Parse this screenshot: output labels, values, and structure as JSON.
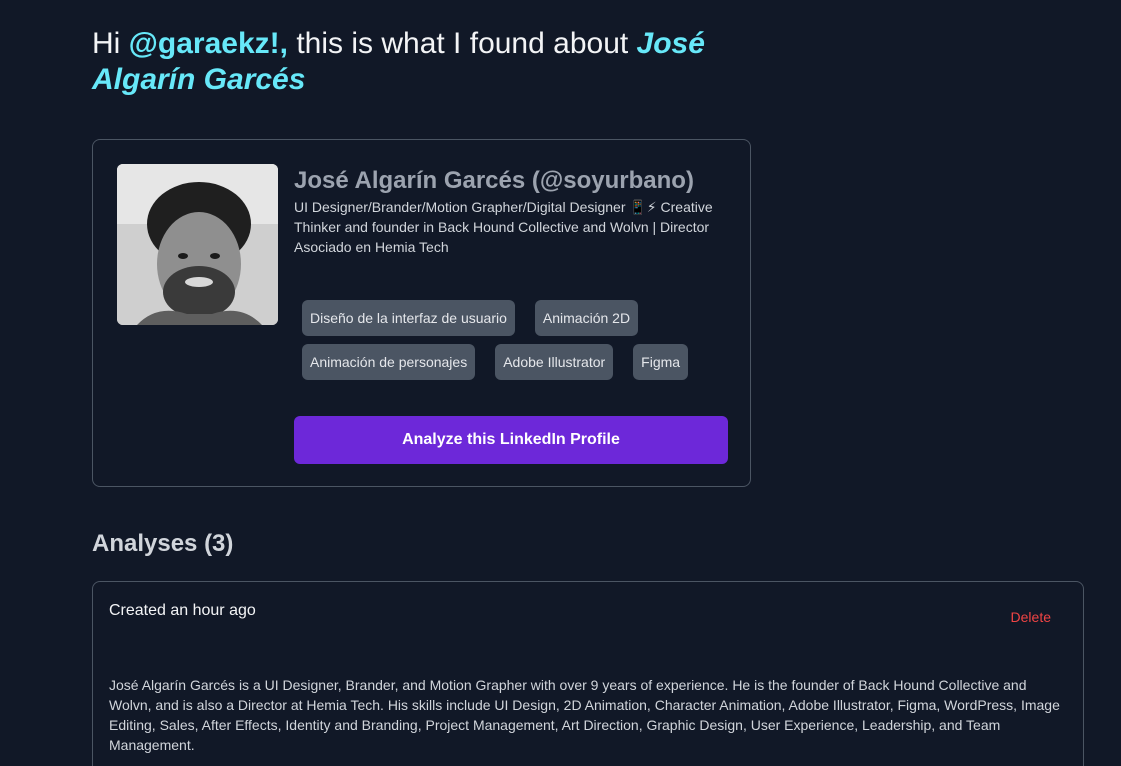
{
  "greeting": {
    "prefix": "Hi ",
    "handle": "@garaekz!,",
    "middle": " this is what I found about ",
    "person": "José Algarín Garcés"
  },
  "profile": {
    "name": "José Algarín Garcés (@soyurbano)",
    "headline": "UI Designer/Brander/Motion Grapher/Digital Designer 📱⚡ Creative Thinker and founder in Back Hound Collective and Wolvn | Director Asociado en Hemia Tech",
    "skills": [
      "Diseño de la interfaz de usuario",
      "Animación 2D",
      "Animación de personajes",
      "Adobe Illustrator",
      "Figma"
    ],
    "analyze_button": "Analyze this LinkedIn Profile"
  },
  "analyses": {
    "heading": "Analyses (3)",
    "items": [
      {
        "created": "Created an hour ago",
        "delete_label": "Delete",
        "text": "José Algarín Garcés is a UI Designer, Brander, and Motion Grapher with over 9 years of experience. He is the founder of Back Hound Collective and Wolvn, and is also a Director at Hemia Tech. His skills include UI Design, 2D Animation, Character Animation, Adobe Illustrator, Figma, WordPress, Image Editing, Sales, After Effects, Identity and Branding, Project Management, Art Direction, Graphic Design, User Experience, Leadership, and Team Management."
      }
    ]
  },
  "colors": {
    "background": "#111827",
    "accent": "#67e8f9",
    "button": "#6d28d9",
    "danger": "#ef4444",
    "chip": "#4b5563"
  }
}
